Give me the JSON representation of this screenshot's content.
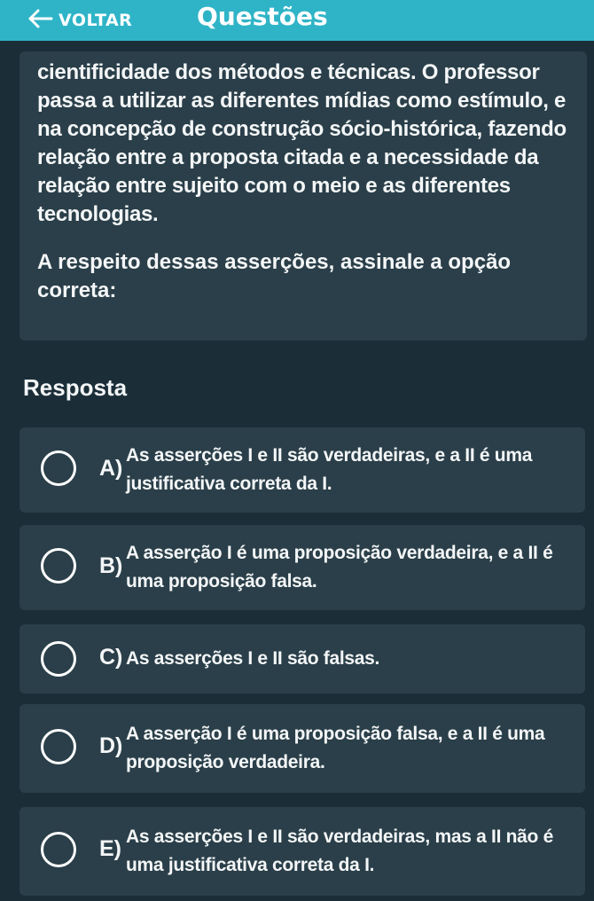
{
  "header": {
    "back_label": "VOLTAR",
    "title": "Questões",
    "bar_color": "#2fb4c7",
    "back_icon": "arrow-left-icon"
  },
  "question": {
    "text": "cientificidade dos métodos e técnicas. O professor passa a utilizar as diferentes mídias como estímulo, e na concepção de construção sócio-histórica, fazendo relação entre a proposta citada e a necessidade da relação entre sujeito com o meio e as diferentes tecnologias.",
    "prompt": "A respeito dessas asserções, assinale a opção correta:"
  },
  "answer_section": {
    "heading": "Resposta"
  },
  "options": [
    {
      "letter": "A)",
      "text": "As asserções I e II são verdadeiras, e a II é uma justificativa correta da I."
    },
    {
      "letter": "B)",
      "text": "A asserção I é uma proposição verdadeira, e a II é uma proposição falsa."
    },
    {
      "letter": "C)",
      "text": "As asserções I e II são falsas."
    },
    {
      "letter": "D)",
      "text": "A asserção I é uma proposição falsa, e a II é uma proposição verdadeira."
    },
    {
      "letter": "E)",
      "text": "As asserções I e II são verdadeiras, mas a II não é uma justificativa correta da I."
    }
  ]
}
